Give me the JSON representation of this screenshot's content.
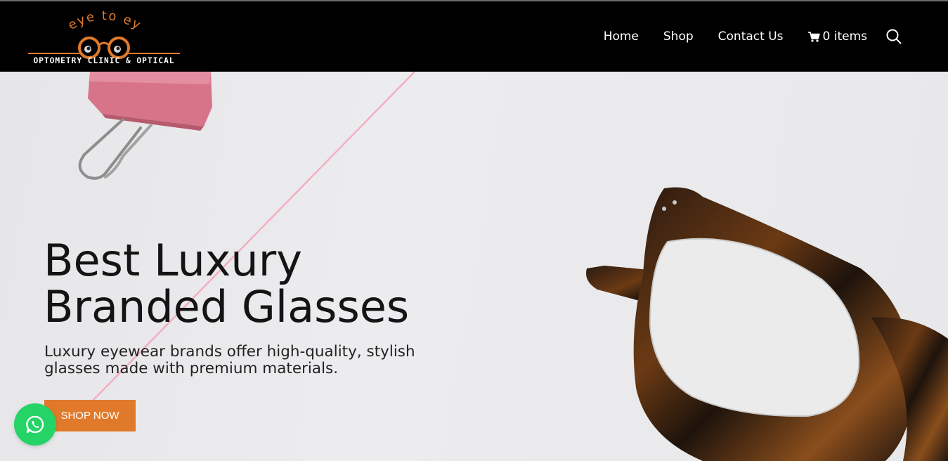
{
  "brand": {
    "logo_top_text": "eye to eye",
    "logo_sub_text": "OPTOMETRY CLINIC & OPTICAL",
    "accent_color": "#e07a2a"
  },
  "nav": {
    "items": [
      {
        "label": "Home"
      },
      {
        "label": "Shop"
      },
      {
        "label": "Contact Us"
      }
    ],
    "cart_label": "0 items",
    "cart_icon": "cart-icon",
    "search_icon": "search-icon"
  },
  "hero": {
    "title_line1": "Best Luxury",
    "title_line2": "Branded Glasses",
    "description": "Luxury eyewear brands offer high-quality, stylish glasses made with premium materials.",
    "cta_label": "SHOP NOW"
  },
  "floating": {
    "whatsapp_icon": "whatsapp-icon",
    "whatsapp_color": "#25d366"
  }
}
